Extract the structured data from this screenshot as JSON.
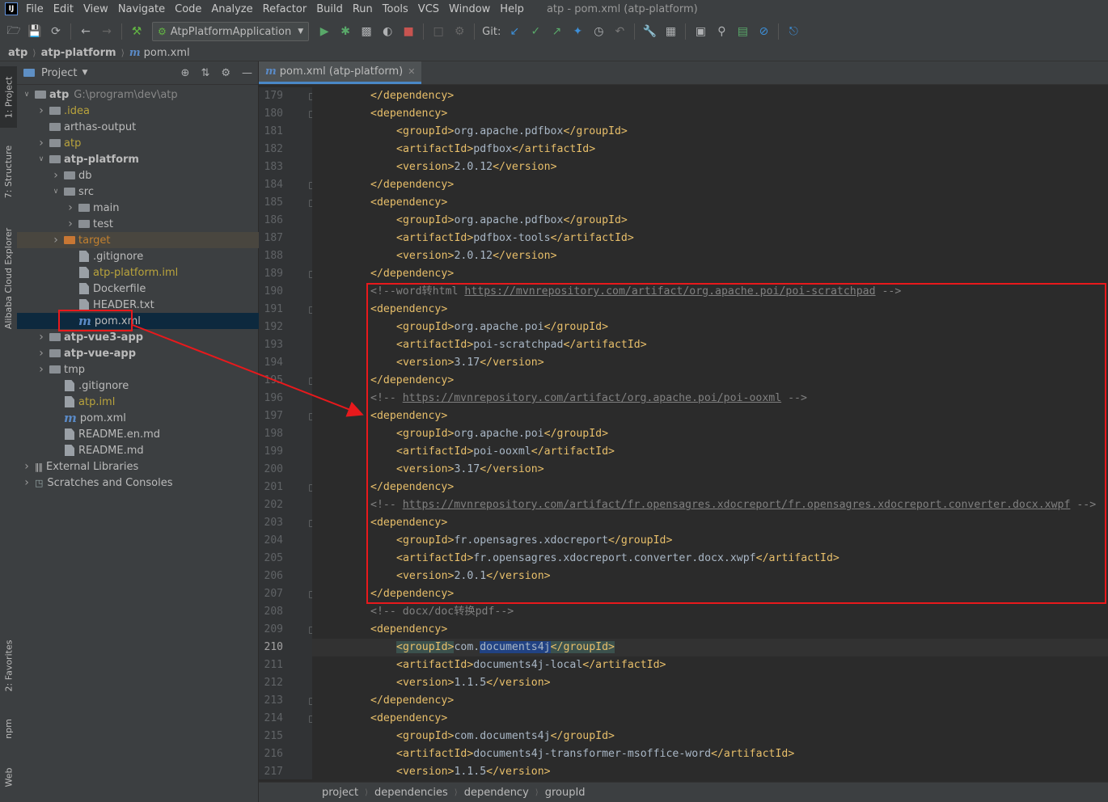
{
  "menubar": {
    "logo": "IJ",
    "items": [
      "File",
      "Edit",
      "View",
      "Navigate",
      "Code",
      "Analyze",
      "Refactor",
      "Build",
      "Run",
      "Tools",
      "VCS",
      "Window",
      "Help"
    ],
    "window_title": "atp - pom.xml (atp-platform)"
  },
  "toolbar": {
    "run_config": "AtpPlatformApplication",
    "git_label": "Git:"
  },
  "breadcrumb": {
    "items": [
      "atp",
      "atp-platform",
      "pom.xml"
    ]
  },
  "left_strip": {
    "tabs": [
      "1: Project",
      "7: Structure",
      "Alibaba Cloud Explorer",
      "2: Favorites",
      "npm",
      "Web"
    ]
  },
  "project_panel": {
    "title": "Project",
    "tree": [
      {
        "label": "atp",
        "note": "G:\\program\\dev\\atp",
        "depth": 0,
        "arrow": "open",
        "icon": "module-folder",
        "style": "bold"
      },
      {
        "label": ".idea",
        "depth": 1,
        "arrow": "closed",
        "icon": "folder",
        "style": "yellow"
      },
      {
        "label": "arthas-output",
        "depth": 1,
        "arrow": "none",
        "icon": "folder",
        "style": "normal"
      },
      {
        "label": "atp",
        "depth": 1,
        "arrow": "closed",
        "icon": "folder",
        "style": "yellow"
      },
      {
        "label": "atp-platform",
        "depth": 1,
        "arrow": "open",
        "icon": "module-folder",
        "style": "bold"
      },
      {
        "label": "db",
        "depth": 2,
        "arrow": "closed",
        "icon": "folder",
        "style": "normal"
      },
      {
        "label": "src",
        "depth": 2,
        "arrow": "open",
        "icon": "folder",
        "style": "normal"
      },
      {
        "label": "main",
        "depth": 3,
        "arrow": "closed",
        "icon": "folder",
        "style": "normal"
      },
      {
        "label": "test",
        "depth": 3,
        "arrow": "closed",
        "icon": "folder",
        "style": "normal"
      },
      {
        "label": "target",
        "depth": 2,
        "arrow": "closed",
        "icon": "folder-orange",
        "style": "orange"
      },
      {
        "label": ".gitignore",
        "depth": 3,
        "arrow": "none",
        "icon": "file",
        "style": "normal"
      },
      {
        "label": "atp-platform.iml",
        "depth": 3,
        "arrow": "none",
        "icon": "file",
        "style": "yellow"
      },
      {
        "label": "Dockerfile",
        "depth": 3,
        "arrow": "none",
        "icon": "file",
        "style": "normal"
      },
      {
        "label": "HEADER.txt",
        "depth": 3,
        "arrow": "none",
        "icon": "file",
        "style": "normal"
      },
      {
        "label": "pom.xml",
        "depth": 3,
        "arrow": "none",
        "icon": "maven",
        "style": "normal",
        "selected": true
      },
      {
        "label": "atp-vue3-app",
        "depth": 1,
        "arrow": "closed",
        "icon": "module-folder",
        "style": "bold"
      },
      {
        "label": "atp-vue-app",
        "depth": 1,
        "arrow": "closed",
        "icon": "module-folder",
        "style": "bold"
      },
      {
        "label": "tmp",
        "depth": 1,
        "arrow": "closed",
        "icon": "folder",
        "style": "normal"
      },
      {
        "label": ".gitignore",
        "depth": 2,
        "arrow": "none",
        "icon": "file",
        "style": "normal"
      },
      {
        "label": "atp.iml",
        "depth": 2,
        "arrow": "none",
        "icon": "file",
        "style": "yellow"
      },
      {
        "label": "pom.xml",
        "depth": 2,
        "arrow": "none",
        "icon": "maven",
        "style": "normal"
      },
      {
        "label": "README.en.md",
        "depth": 2,
        "arrow": "none",
        "icon": "file",
        "style": "normal"
      },
      {
        "label": "README.md",
        "depth": 2,
        "arrow": "none",
        "icon": "file",
        "style": "normal"
      },
      {
        "label": "External Libraries",
        "depth": 0,
        "arrow": "closed",
        "icon": "library",
        "style": "normal"
      },
      {
        "label": "Scratches and Consoles",
        "depth": 0,
        "arrow": "closed",
        "icon": "scratch",
        "style": "normal"
      }
    ]
  },
  "editor": {
    "tab_label": "pom.xml (atp-platform)",
    "current_line": 210,
    "lines": [
      {
        "n": "179",
        "indent": 2,
        "parts": [
          [
            "tag",
            "</dependency>"
          ]
        ]
      },
      {
        "n": "180",
        "indent": 2,
        "parts": [
          [
            "tag",
            "<dependency>"
          ]
        ]
      },
      {
        "n": "181",
        "indent": 3,
        "parts": [
          [
            "tag",
            "<groupId>"
          ],
          [
            "tx",
            "org.apache.pdfbox"
          ],
          [
            "tag",
            "</groupId>"
          ]
        ]
      },
      {
        "n": "182",
        "indent": 3,
        "parts": [
          [
            "tag",
            "<artifactId>"
          ],
          [
            "tx",
            "pdfbox"
          ],
          [
            "tag",
            "</artifactId>"
          ]
        ]
      },
      {
        "n": "183",
        "indent": 3,
        "parts": [
          [
            "tag",
            "<version>"
          ],
          [
            "tx",
            "2.0.12"
          ],
          [
            "tag",
            "</version>"
          ]
        ]
      },
      {
        "n": "184",
        "indent": 2,
        "parts": [
          [
            "tag",
            "</dependency>"
          ]
        ]
      },
      {
        "n": "185",
        "indent": 2,
        "parts": [
          [
            "tag",
            "<dependency>"
          ]
        ]
      },
      {
        "n": "186",
        "indent": 3,
        "parts": [
          [
            "tag",
            "<groupId>"
          ],
          [
            "tx",
            "org.apache.pdfbox"
          ],
          [
            "tag",
            "</groupId>"
          ]
        ]
      },
      {
        "n": "187",
        "indent": 3,
        "parts": [
          [
            "tag",
            "<artifactId>"
          ],
          [
            "tx",
            "pdfbox-tools"
          ],
          [
            "tag",
            "</artifactId>"
          ]
        ]
      },
      {
        "n": "188",
        "indent": 3,
        "parts": [
          [
            "tag",
            "<version>"
          ],
          [
            "tx",
            "2.0.12"
          ],
          [
            "tag",
            "</version>"
          ]
        ]
      },
      {
        "n": "189",
        "indent": 2,
        "parts": [
          [
            "tag",
            "</dependency>"
          ]
        ]
      },
      {
        "n": "190",
        "indent": 2,
        "parts": [
          [
            "cm",
            "<!--word转html "
          ],
          [
            "url",
            "https://mvnrepository.com/artifact/org.apache.poi/poi-scratchpad"
          ],
          [
            "cm",
            " -->"
          ]
        ]
      },
      {
        "n": "191",
        "indent": 2,
        "parts": [
          [
            "tag",
            "<dependency>"
          ]
        ]
      },
      {
        "n": "192",
        "indent": 3,
        "parts": [
          [
            "tag",
            "<groupId>"
          ],
          [
            "tx",
            "org.apache.poi"
          ],
          [
            "tag",
            "</groupId>"
          ]
        ]
      },
      {
        "n": "193",
        "indent": 3,
        "parts": [
          [
            "tag",
            "<artifactId>"
          ],
          [
            "tx",
            "poi-scratchpad"
          ],
          [
            "tag",
            "</artifactId>"
          ]
        ]
      },
      {
        "n": "194",
        "indent": 3,
        "parts": [
          [
            "tag",
            "<version>"
          ],
          [
            "tx",
            "3.17"
          ],
          [
            "tag",
            "</version>"
          ]
        ]
      },
      {
        "n": "195",
        "indent": 2,
        "parts": [
          [
            "tag",
            "</dependency>"
          ]
        ]
      },
      {
        "n": "196",
        "indent": 2,
        "parts": [
          [
            "cm",
            "<!-- "
          ],
          [
            "url",
            "https://mvnrepository.com/artifact/org.apache.poi/poi-ooxml"
          ],
          [
            "cm",
            " -->"
          ]
        ]
      },
      {
        "n": "197",
        "indent": 2,
        "parts": [
          [
            "tag",
            "<dependency>"
          ]
        ]
      },
      {
        "n": "198",
        "indent": 3,
        "parts": [
          [
            "tag",
            "<groupId>"
          ],
          [
            "tx",
            "org.apache.poi"
          ],
          [
            "tag",
            "</groupId>"
          ]
        ]
      },
      {
        "n": "199",
        "indent": 3,
        "parts": [
          [
            "tag",
            "<artifactId>"
          ],
          [
            "tx",
            "poi-ooxml"
          ],
          [
            "tag",
            "</artifactId>"
          ]
        ]
      },
      {
        "n": "200",
        "indent": 3,
        "parts": [
          [
            "tag",
            "<version>"
          ],
          [
            "tx",
            "3.17"
          ],
          [
            "tag",
            "</version>"
          ]
        ]
      },
      {
        "n": "201",
        "indent": 2,
        "parts": [
          [
            "tag",
            "</dependency>"
          ]
        ]
      },
      {
        "n": "202",
        "indent": 2,
        "parts": [
          [
            "cm",
            "<!-- "
          ],
          [
            "url",
            "https://mvnrepository.com/artifact/fr.opensagres.xdocreport/fr.opensagres.xdocreport.converter.docx.xwpf"
          ],
          [
            "cm",
            " -->"
          ]
        ]
      },
      {
        "n": "203",
        "indent": 2,
        "parts": [
          [
            "tag",
            "<dependency>"
          ]
        ]
      },
      {
        "n": "204",
        "indent": 3,
        "parts": [
          [
            "tag",
            "<groupId>"
          ],
          [
            "tx",
            "fr.opensagres.xdocreport"
          ],
          [
            "tag",
            "</groupId>"
          ]
        ]
      },
      {
        "n": "205",
        "indent": 3,
        "parts": [
          [
            "tag",
            "<artifactId>"
          ],
          [
            "tx",
            "fr.opensagres.xdocreport.converter.docx.xwpf"
          ],
          [
            "tag",
            "</artifactId>"
          ]
        ]
      },
      {
        "n": "206",
        "indent": 3,
        "parts": [
          [
            "tag",
            "<version>"
          ],
          [
            "tx",
            "2.0.1"
          ],
          [
            "tag",
            "</version>"
          ]
        ]
      },
      {
        "n": "207",
        "indent": 2,
        "parts": [
          [
            "tag",
            "</dependency>"
          ]
        ]
      },
      {
        "n": "208",
        "indent": 2,
        "parts": [
          [
            "cm",
            "<!-- docx/doc转换pdf-->"
          ]
        ]
      },
      {
        "n": "209",
        "indent": 2,
        "parts": [
          [
            "tag",
            "<dependency>"
          ]
        ]
      },
      {
        "n": "210",
        "indent": 3,
        "parts": [
          [
            "taghl",
            "<groupId>"
          ],
          [
            "tx",
            "com."
          ],
          [
            "wordhl",
            "documents4j"
          ],
          [
            "taghl",
            "</groupId>"
          ]
        ]
      },
      {
        "n": "211",
        "indent": 3,
        "parts": [
          [
            "tag",
            "<artifactId>"
          ],
          [
            "tx",
            "documents4j-local"
          ],
          [
            "tag",
            "</artifactId>"
          ]
        ]
      },
      {
        "n": "212",
        "indent": 3,
        "parts": [
          [
            "tag",
            "<version>"
          ],
          [
            "tx",
            "1.1.5"
          ],
          [
            "tag",
            "</version>"
          ]
        ]
      },
      {
        "n": "213",
        "indent": 2,
        "parts": [
          [
            "tag",
            "</dependency>"
          ]
        ]
      },
      {
        "n": "214",
        "indent": 2,
        "parts": [
          [
            "tag",
            "<dependency>"
          ]
        ]
      },
      {
        "n": "215",
        "indent": 3,
        "parts": [
          [
            "tag",
            "<groupId>"
          ],
          [
            "tx",
            "com.documents4j"
          ],
          [
            "tag",
            "</groupId>"
          ]
        ]
      },
      {
        "n": "216",
        "indent": 3,
        "parts": [
          [
            "tag",
            "<artifactId>"
          ],
          [
            "tx",
            "documents4j-transformer-msoffice-word"
          ],
          [
            "tag",
            "</artifactId>"
          ]
        ]
      },
      {
        "n": "217",
        "indent": 3,
        "parts": [
          [
            "tag",
            "<version>"
          ],
          [
            "tx",
            "1.1.5"
          ],
          [
            "tag",
            "</version>"
          ]
        ]
      }
    ]
  },
  "status_bar": {
    "path": [
      "project",
      "dependencies",
      "dependency",
      "groupId"
    ]
  },
  "annotation": {
    "color": "#e8191c"
  }
}
